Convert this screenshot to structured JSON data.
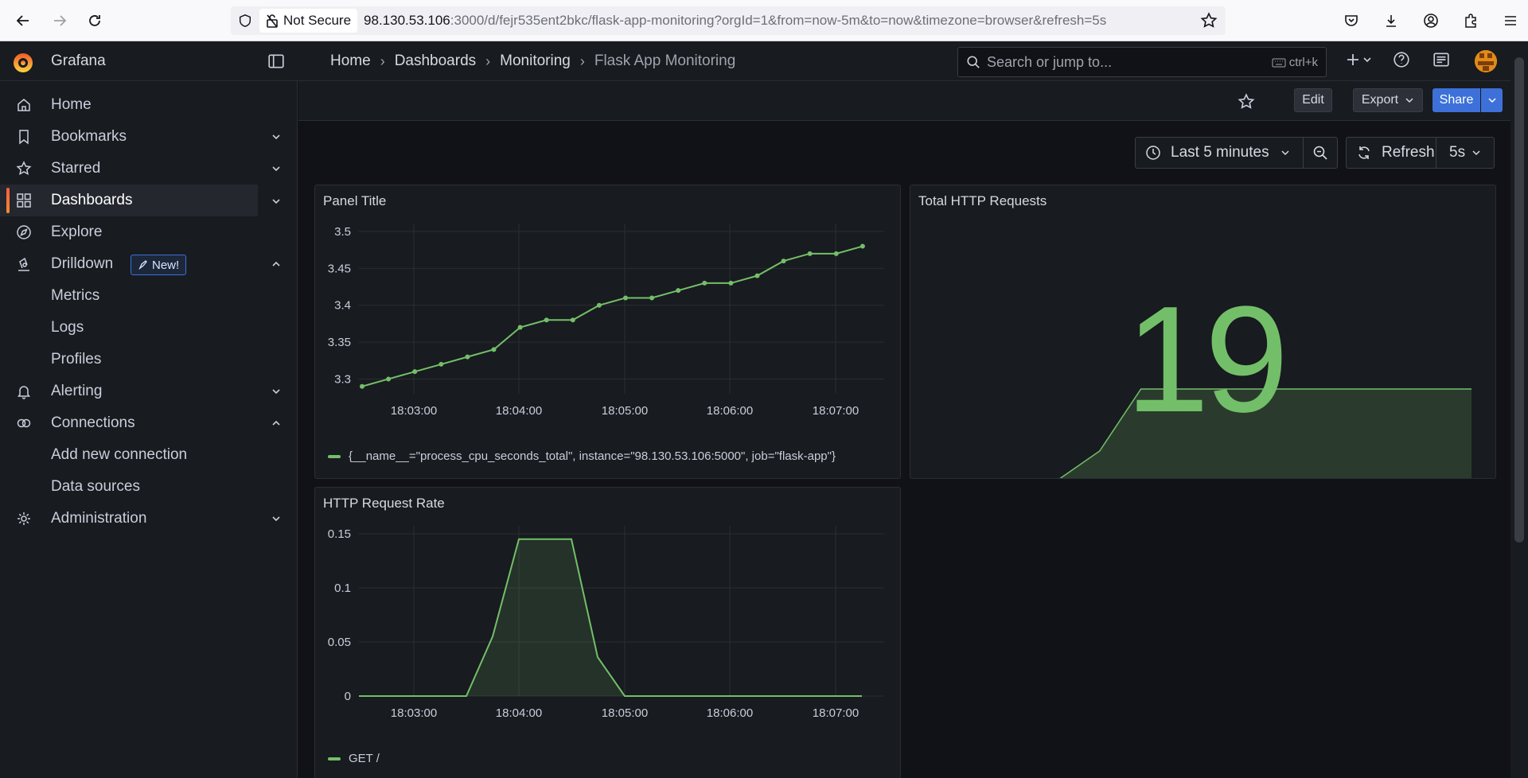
{
  "browser": {
    "security_label": "Not Secure",
    "url_host": "98.130.53.106",
    "url_rest": ":3000/d/fejr535ent2bkc/flask-app-monitoring?orgId=1&from=now-5m&to=now&timezone=browser&refresh=5s"
  },
  "app": {
    "brand": "Grafana"
  },
  "breadcrumb": [
    "Home",
    "Dashboards",
    "Monitoring",
    "Flask App Monitoring"
  ],
  "search": {
    "placeholder": "Search or jump to...",
    "shortcut": "ctrl+k"
  },
  "sidebar": {
    "items": [
      {
        "label": "Home",
        "icon": "home-icon"
      },
      {
        "label": "Bookmarks",
        "icon": "bookmark-icon"
      },
      {
        "label": "Starred",
        "icon": "star-icon"
      },
      {
        "label": "Dashboards",
        "icon": "apps-icon"
      },
      {
        "label": "Explore",
        "icon": "compass-icon"
      },
      {
        "label": "Drilldown",
        "icon": "drilldown-icon",
        "badge": "New!"
      },
      {
        "label": "Metrics"
      },
      {
        "label": "Logs"
      },
      {
        "label": "Profiles"
      },
      {
        "label": "Alerting",
        "icon": "bell-icon"
      },
      {
        "label": "Connections",
        "icon": "link-icon"
      },
      {
        "label": "Add new connection"
      },
      {
        "label": "Data sources"
      },
      {
        "label": "Administration",
        "icon": "cog-icon"
      }
    ]
  },
  "toolbar": {
    "edit": "Edit",
    "export": "Export",
    "share": "Share"
  },
  "time": {
    "range": "Last 5 minutes",
    "refresh": "Refresh",
    "interval": "5s"
  },
  "panels": {
    "cpu": {
      "title": "Panel Title",
      "legend": "{__name__=\"process_cpu_seconds_total\", instance=\"98.130.53.106:5000\", job=\"flask-app\"}"
    },
    "total": {
      "title": "Total HTTP Requests",
      "value": "19"
    },
    "rate": {
      "title": "HTTP Request Rate",
      "legend": "GET /"
    }
  },
  "colors": {
    "series": "#73bf69",
    "accent": "#3d71d9",
    "brand": "#f55f3e"
  },
  "chart_data": [
    {
      "type": "line",
      "title": "Panel Title",
      "x": [
        "18:02:45",
        "18:02:57",
        "18:03:09",
        "18:03:21",
        "18:03:33",
        "18:03:45",
        "18:03:57",
        "18:04:09",
        "18:04:21",
        "18:04:33",
        "18:04:45",
        "18:04:57",
        "18:05:09",
        "18:05:21",
        "18:05:33",
        "18:05:45",
        "18:05:57",
        "18:06:09",
        "18:06:21",
        "18:06:33",
        "18:06:45",
        "18:06:57",
        "18:07:09"
      ],
      "xticks": [
        "18:03:00",
        "18:04:00",
        "18:05:00",
        "18:06:00",
        "18:07:00"
      ],
      "yticks": [
        "3.3",
        "3.35",
        "3.4",
        "3.45",
        "3.5"
      ],
      "ylim": [
        3.28,
        3.5
      ],
      "series": [
        {
          "name": "{__name__=\"process_cpu_seconds_total\", instance=\"98.130.53.106:5000\", job=\"flask-app\"}",
          "values": [
            3.29,
            3.3,
            3.31,
            3.32,
            3.33,
            3.34,
            3.37,
            3.38,
            3.38,
            3.4,
            3.41,
            3.41,
            3.42,
            3.43,
            3.43,
            3.44,
            3.46,
            3.47,
            3.47,
            3.48
          ]
        }
      ]
    },
    {
      "type": "area",
      "title": "HTTP Request Rate",
      "xticks": [
        "18:03:00",
        "18:04:00",
        "18:05:00",
        "18:06:00",
        "18:07:00"
      ],
      "yticks": [
        "0",
        "0.05",
        "0.1",
        "0.15"
      ],
      "ylim": [
        0,
        0.15
      ],
      "series": [
        {
          "name": "GET /",
          "values": [
            0,
            0,
            0,
            0,
            0,
            0.055,
            0.145,
            0.145,
            0.145,
            0.036,
            0,
            0,
            0,
            0,
            0,
            0,
            0,
            0,
            0,
            0
          ]
        }
      ]
    },
    {
      "type": "area",
      "title": "Total HTTP Requests",
      "value": 19,
      "series": [
        {
          "name": "sparkline",
          "values": [
            0,
            0,
            0,
            0,
            6,
            19,
            19,
            19,
            19,
            19,
            19,
            19,
            19,
            19
          ]
        }
      ]
    }
  ]
}
